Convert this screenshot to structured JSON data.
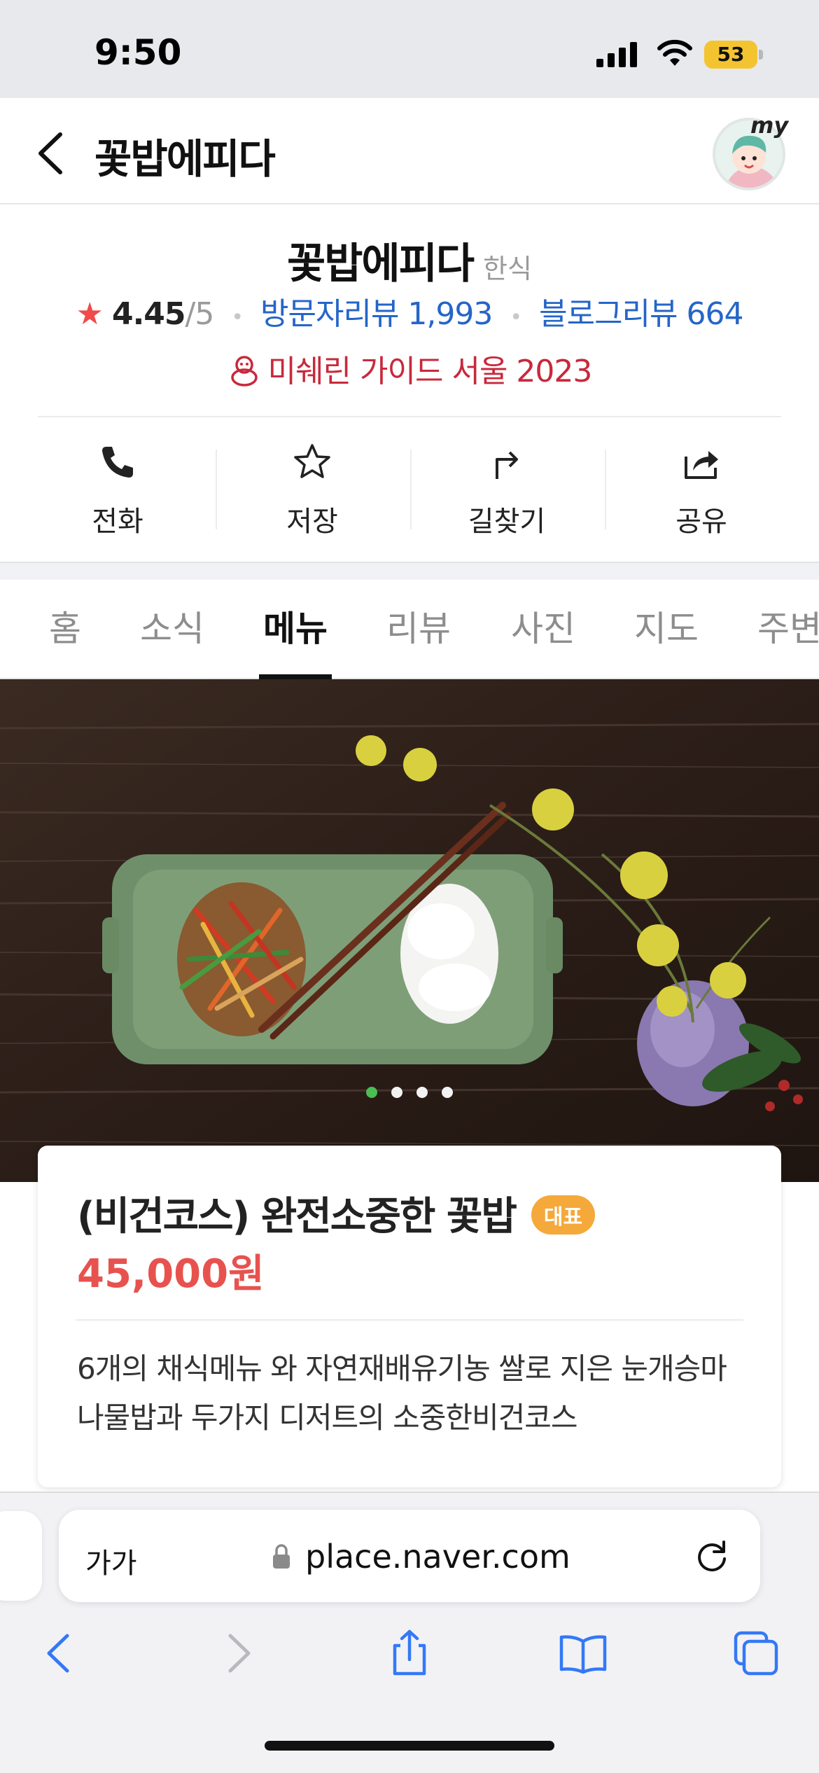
{
  "status": {
    "time": "9:50",
    "battery": "53"
  },
  "header": {
    "title": "꽃밥에피다",
    "avatar_label": "my"
  },
  "place": {
    "name": "꽃밥에피다",
    "category": "한식",
    "rating": "4.45",
    "rating_max": "/5",
    "visitor_reviews": "방문자리뷰 1,993",
    "blog_reviews": "블로그리뷰 664",
    "award": "미쉐린 가이드 서울 2023"
  },
  "actions": [
    {
      "label": "전화",
      "icon": "phone-icon"
    },
    {
      "label": "저장",
      "icon": "star-outline-icon"
    },
    {
      "label": "길찾기",
      "icon": "directions-icon"
    },
    {
      "label": "공유",
      "icon": "share-icon"
    }
  ],
  "tabs": [
    {
      "label": "홈"
    },
    {
      "label": "소식"
    },
    {
      "label": "메뉴",
      "active": true
    },
    {
      "label": "리뷰"
    },
    {
      "label": "사진"
    },
    {
      "label": "지도"
    },
    {
      "label": "주변"
    }
  ],
  "carousel": {
    "count": 4,
    "active_index": 0
  },
  "menu_item": {
    "name": "(비건코스) 완전소중한 꽃밥",
    "badge": "대표",
    "price": "45,000원",
    "description": "6개의 채식메뉴 와 자연재배유기농 쌀로 지은 눈개승마나물밥과 두가지 디저트의 소중한비건코스"
  },
  "browser": {
    "aa_label": "가가",
    "url": "place.naver.com"
  },
  "colors": {
    "accent_red": "#e8524e",
    "link_blue": "#2565c8",
    "michelin_red": "#c8293c",
    "badge_orange": "#f4a93a",
    "ios_blue": "#3478f6"
  }
}
